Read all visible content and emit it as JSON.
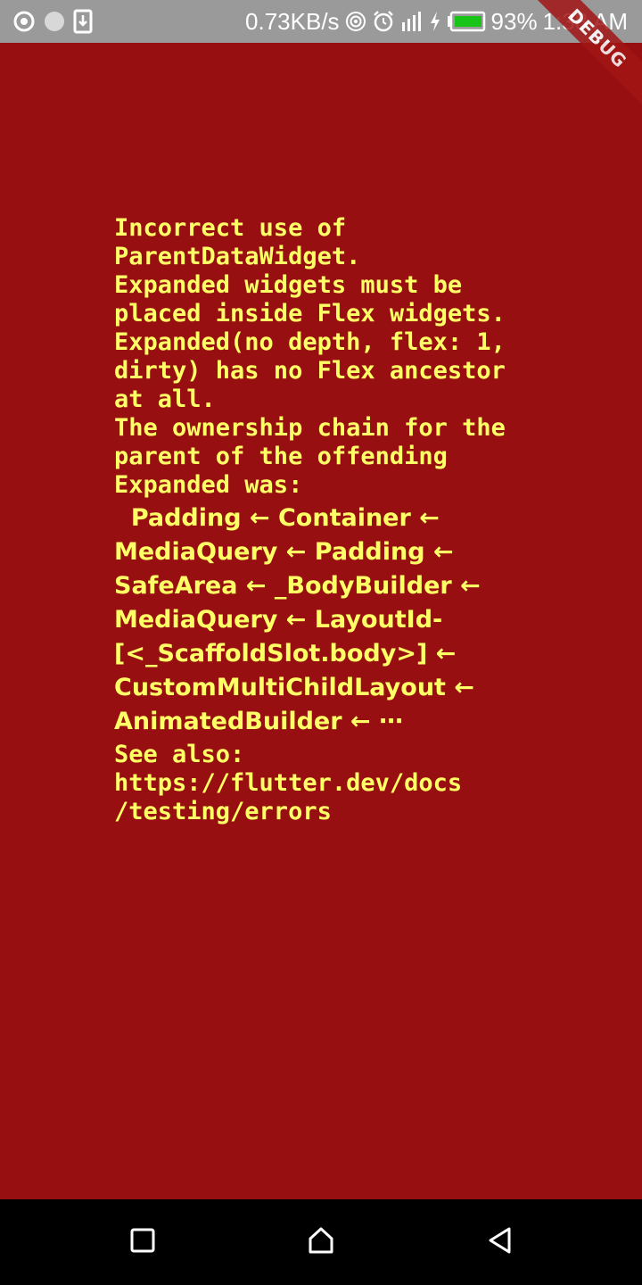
{
  "status_bar": {
    "net_speed": "0.73KB/s",
    "battery": "93%",
    "time": "1:38 AM",
    "icons": [
      "record-icon",
      "circle-icon",
      "download-icon",
      "hotspot-icon",
      "alarm-icon",
      "signal-icon",
      "charging-icon",
      "battery-icon"
    ]
  },
  "debug_banner": "DEBUG",
  "error": {
    "line1": "Incorrect use of\nParentDataWidget.\nExpanded widgets must be\nplaced inside Flex widgets.\nExpanded(no depth, flex: 1,\ndirty) has no Flex ancestor\nat all.\nThe ownership chain for the\nparent of the offending\nExpanded was:",
    "chain": "  Padding ← Container ←\nMediaQuery ← Padding ←\nSafeArea ← _BodyBuilder ←\nMediaQuery ← LayoutId-\n[<_ScaffoldSlot.body>] ←\nCustomMultiChildLayout ←\nAnimatedBuilder ← ⋯",
    "see_also": "See also:\nhttps://flutter.dev/docs\n/testing/errors"
  },
  "colors": {
    "background": "#970f10",
    "text": "#ffff66",
    "status_bar": "#9a9a9a"
  },
  "nav": {
    "icons": [
      "recents-icon",
      "home-icon",
      "back-icon"
    ]
  }
}
